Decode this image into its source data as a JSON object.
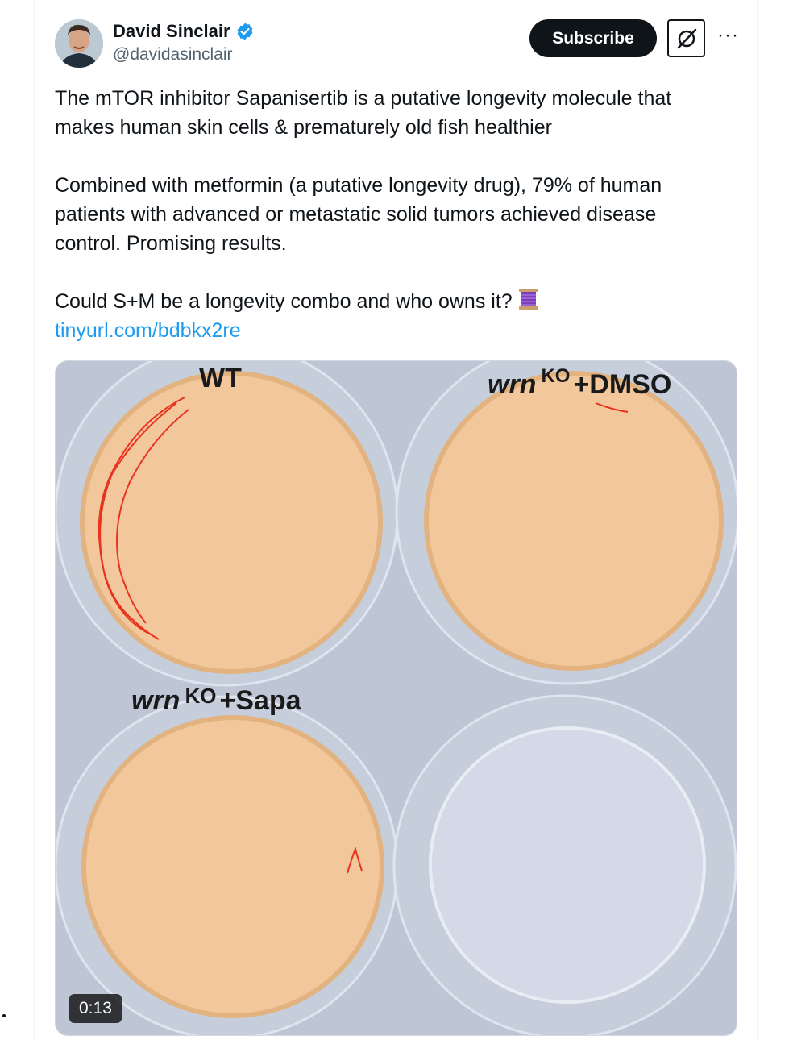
{
  "author": {
    "name": "David Sinclair",
    "handle": "@davidasinclair",
    "verified": true,
    "avatar_icon": "avatar-photo"
  },
  "actions": {
    "subscribe_label": "Subscribe",
    "grok_icon": "grok-icon",
    "more_label": "···"
  },
  "tweet": {
    "paragraph1": "The mTOR inhibitor Sapanisertib is a putative longevity molecule that makes human skin cells & prematurely old fish healthier",
    "paragraph2": "Combined with metformin (a putative longevity drug), 79% of human patients with advanced or metastatic solid tumors achieved disease control. Promising results.",
    "paragraph3": "Could S+M be a longevity combo and who owns it?",
    "emoji_icon": "thread-spool-emoji",
    "link": "tinyurl.com/bdbkx2re"
  },
  "media": {
    "label_wt": "WT",
    "label_dmso_prefix": "wrn",
    "label_dmso_sup": "KO",
    "label_dmso_suffix": "+DMSO",
    "label_sapa_prefix": "wrn",
    "label_sapa_sup": "KO",
    "label_sapa_suffix": "+Sapa",
    "duration": "0:13"
  },
  "colors": {
    "accent": "#1d9bf0",
    "button_bg": "#0f1419",
    "text_secondary": "#536471",
    "dish_fill": "#f2c79c",
    "plate_bg": "#bfc7d8",
    "fish_trail": "#e8331e"
  }
}
